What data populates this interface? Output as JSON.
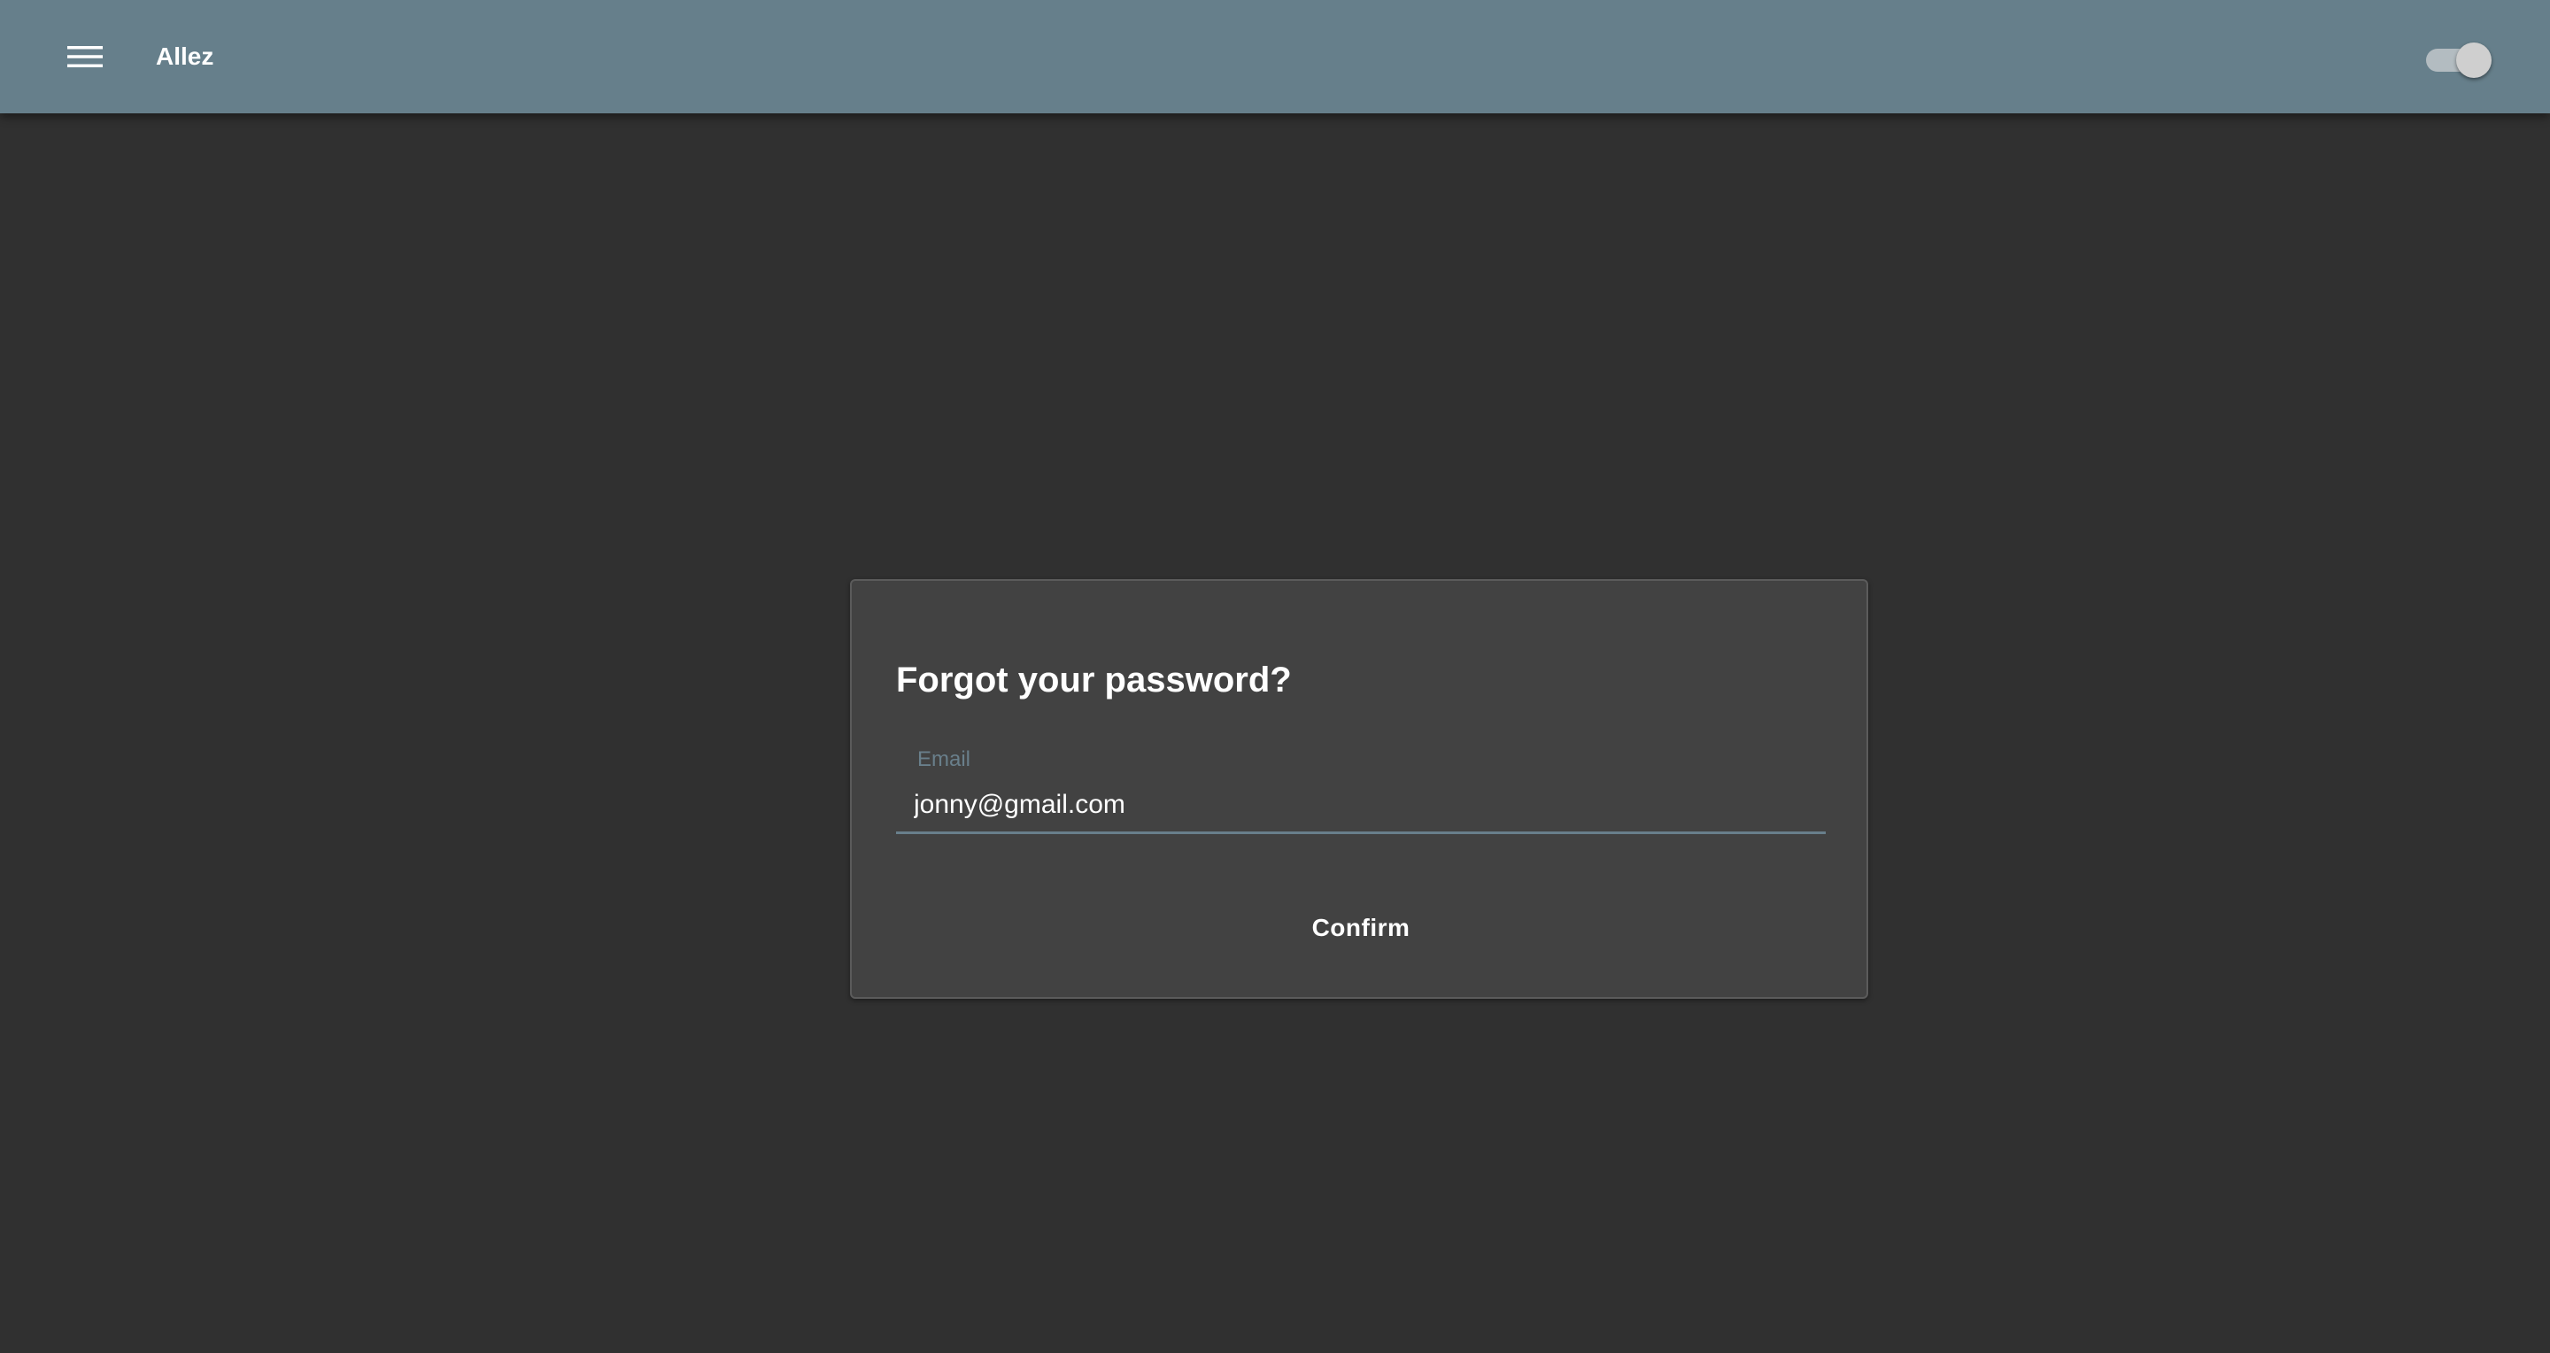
{
  "app_bar": {
    "title": "Allez",
    "menu_icon": "hamburger-menu-icon",
    "theme_toggle": {
      "icon": "toggle-switch-icon",
      "checked": true
    },
    "background_color": "#667f8b"
  },
  "form": {
    "title": "Forgot your password?",
    "email_label": "Email",
    "email_value": "jonny@gmail.com",
    "confirm_label": "Confirm",
    "accent_color": "#697f8b",
    "card_color": "#424242",
    "page_color": "#303030"
  }
}
